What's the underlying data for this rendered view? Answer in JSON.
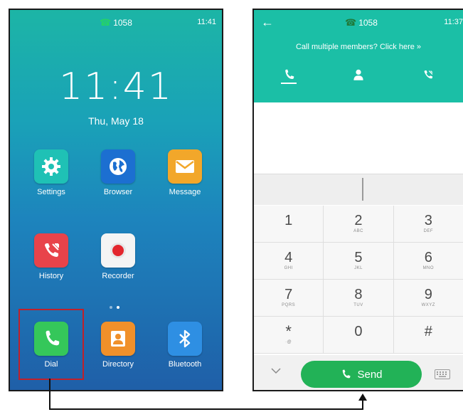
{
  "home_screen": {
    "status": {
      "extension": "1058",
      "time": "11:41"
    },
    "clock": {
      "time": "11:41",
      "date": "Thu, May 18"
    },
    "apps": [
      {
        "label": "Settings",
        "icon": "gear-icon",
        "color": "#1fc1b5"
      },
      {
        "label": "Browser",
        "icon": "globe-icon",
        "color": "#1c6fd1"
      },
      {
        "label": "Message",
        "icon": "envelope-icon",
        "color": "#f2a72a"
      },
      {
        "label": "History",
        "icon": "call-history-icon",
        "color": "#e8434a"
      },
      {
        "label": "Recorder",
        "icon": "record-icon",
        "color": "#f4f4f4"
      }
    ],
    "dock": [
      {
        "label": "Dial",
        "icon": "phone-icon",
        "color": "#35c75a",
        "highlighted": true
      },
      {
        "label": "Directory",
        "icon": "contact-icon",
        "color": "#f0902a"
      },
      {
        "label": "Bluetooth",
        "icon": "bluetooth-icon",
        "color": "#2e8fe3"
      }
    ],
    "page_indicator": {
      "pages": 2,
      "current": 2
    },
    "highlight_color": "#c0202a"
  },
  "dialer": {
    "status": {
      "extension": "1058",
      "time": "11:37"
    },
    "multi_member_link": "Call multiple members? Click here »",
    "tabs": [
      {
        "icon": "phone-icon",
        "active": true
      },
      {
        "icon": "contacts-icon",
        "active": false
      },
      {
        "icon": "call-history-icon",
        "active": false
      }
    ],
    "keypad": [
      [
        {
          "digit": "1",
          "letters": ""
        },
        {
          "digit": "2",
          "letters": "ABC"
        },
        {
          "digit": "3",
          "letters": "DEF"
        }
      ],
      [
        {
          "digit": "4",
          "letters": "GHI"
        },
        {
          "digit": "5",
          "letters": "JKL"
        },
        {
          "digit": "6",
          "letters": "MNO"
        }
      ],
      [
        {
          "digit": "7",
          "letters": "PQRS"
        },
        {
          "digit": "8",
          "letters": "TUV"
        },
        {
          "digit": "9",
          "letters": "WXYZ"
        }
      ],
      [
        {
          "digit": "*",
          "letters": "·@"
        },
        {
          "digit": "0",
          "letters": ""
        },
        {
          "digit": "#",
          "letters": ""
        }
      ]
    ],
    "send_label": "Send",
    "accent_color": "#1bbfa6",
    "send_color": "#22b257"
  }
}
